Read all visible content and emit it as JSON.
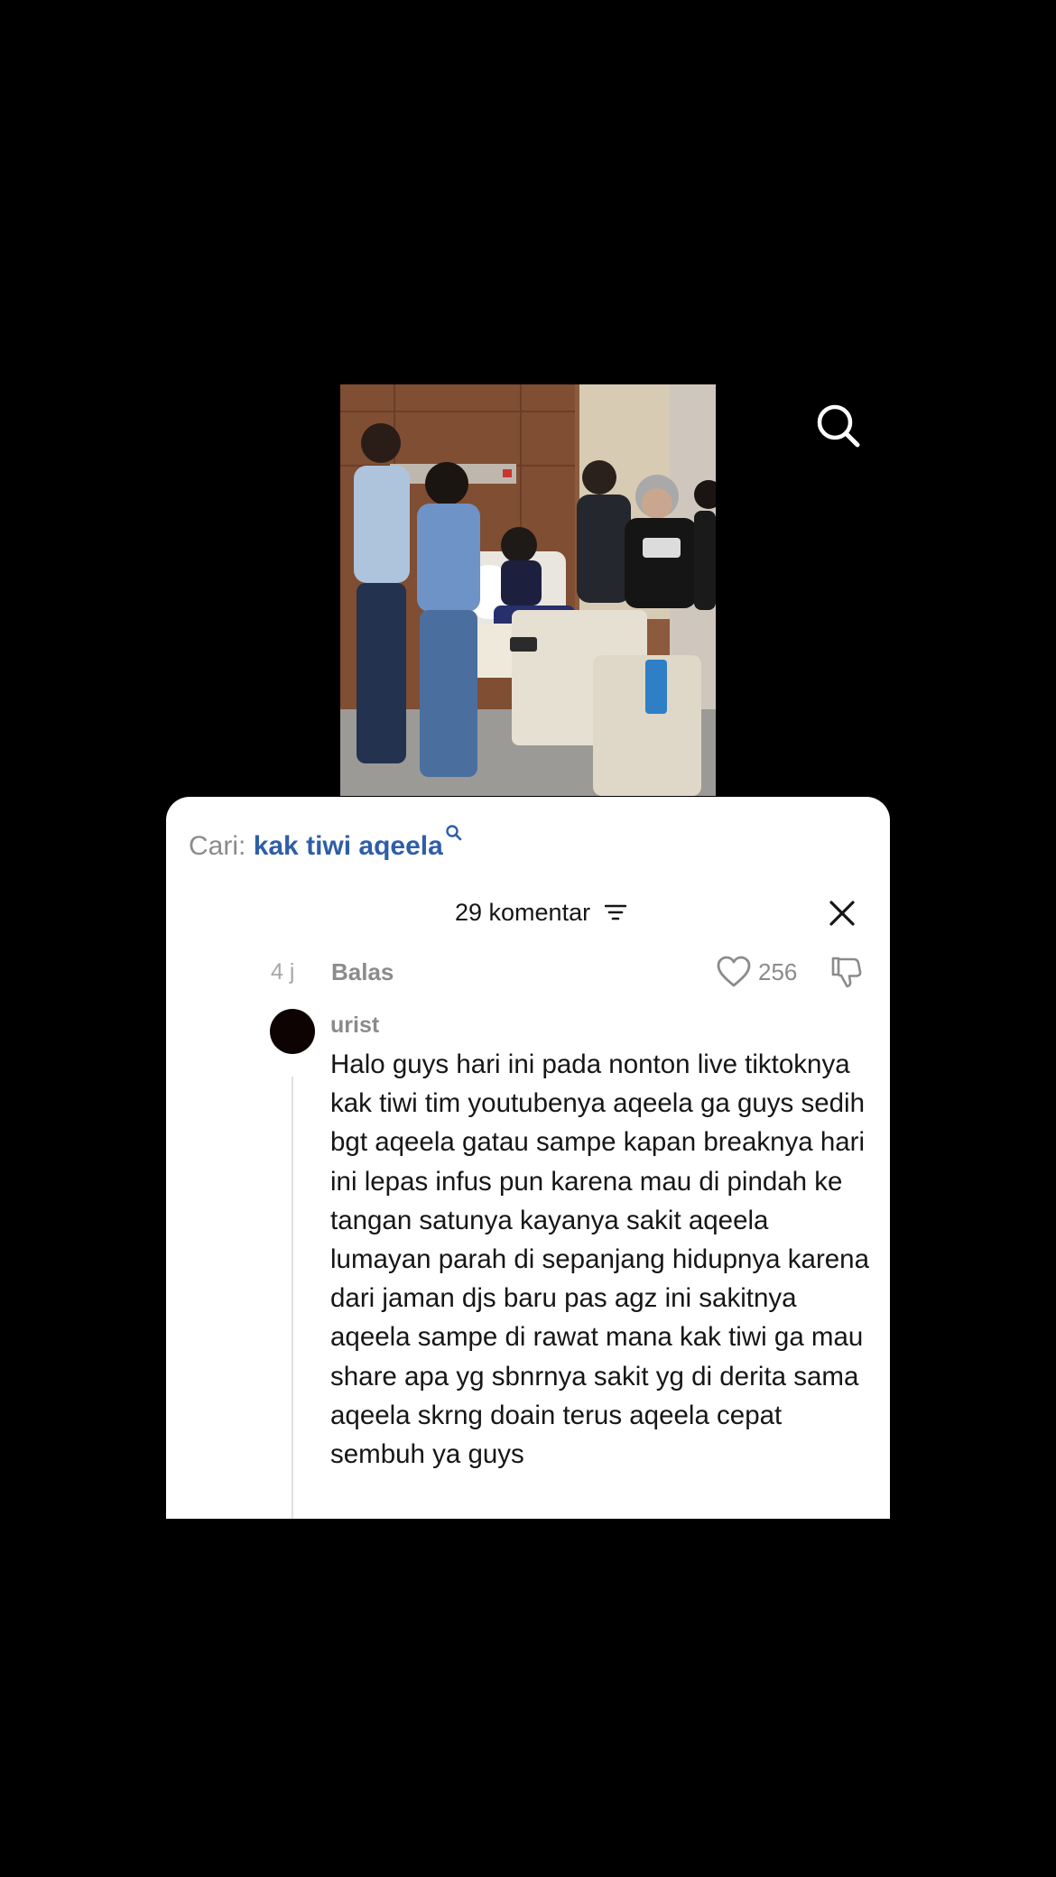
{
  "search": {
    "prefix": "Cari:",
    "query": "kak tiwi aqeela"
  },
  "header": {
    "comment_count_label": "29 komentar"
  },
  "comment": {
    "time": "4 j",
    "reply_label": "Balas",
    "like_count": "256",
    "username": "urist",
    "text": "Halo guys hari ini pada nonton live tiktoknya kak tiwi tim youtubenya aqeela ga guys sedih bgt aqeela gatau sampe kapan breaknya hari ini lepas infus pun karena mau di pindah ke tangan satunya kayanya sakit aqeela lumayan parah di sepanjang hidupnya karena dari jaman djs baru pas agz ini sakitnya aqeela sampe di rawat mana kak tiwi ga mau share apa yg sbnrnya sakit yg di derita sama aqeela skrng doain terus aqeela cepat sembuh ya guys"
  },
  "icons": {
    "search": "search-icon",
    "search_mini": "magnifier-icon",
    "filter": "filter-lines-icon",
    "close": "close-icon",
    "like": "heart-outline-icon",
    "dislike": "thumbs-down-outline-icon"
  },
  "colors": {
    "background": "#000000",
    "sheet": "#ffffff",
    "accent_query": "#2f5ea8",
    "muted_text": "#8b8b8b",
    "primary_text": "#161616"
  }
}
